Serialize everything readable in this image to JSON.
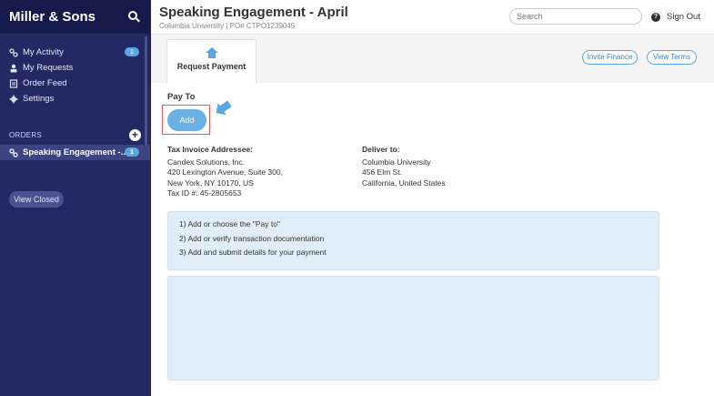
{
  "sidebar": {
    "brand": "Miller & Sons",
    "nav": [
      {
        "label": "My Activity",
        "icon": "activity-link-icon",
        "badge": "1"
      },
      {
        "label": "My Requests",
        "icon": "person-icon",
        "badge": null
      },
      {
        "label": "Order Feed",
        "icon": "document-icon",
        "badge": null
      },
      {
        "label": "Settings",
        "icon": "gear-icon",
        "badge": null
      }
    ],
    "orders_heading": "ORDERS",
    "orders": [
      {
        "label": "Speaking Engagement -...",
        "badge": "1",
        "icon": "link-icon"
      }
    ],
    "view_closed_label": "View Closed"
  },
  "header": {
    "title": "Speaking Engagement - April",
    "subtitle": "Columbia University  |  PO# CTPO1239045",
    "search_placeholder": "Search",
    "help_glyph": "?",
    "signout_label": "Sign Out"
  },
  "tabs": {
    "active_tab_label": "Request Payment",
    "invite_finance_label": "Invite Finance",
    "view_terms_label": "View Terms"
  },
  "payment": {
    "pay_to_label": "Pay To",
    "add_label": "Add",
    "tax_invoice": {
      "heading": "Tax Invoice Addressee:",
      "lines": [
        "Candex Solutions, Inc.",
        "420 Lexington Avenue, Suite 300,",
        "New York, NY 10170, US",
        "Tax ID #: 45-2805653"
      ]
    },
    "deliver_to": {
      "heading": "Deliver to:",
      "lines": [
        "Columbia University",
        "456 Elm St.",
        "California, United States"
      ]
    },
    "steps": [
      "1)  Add or choose the \"Pay to\"",
      "2)  Add or verify transaction documentation",
      "3)  Add and submit details for your payment"
    ]
  },
  "colors": {
    "sidebar_bg": "#232a63",
    "brand_bar_bg": "#141a4a",
    "accent": "#5aa7de",
    "highlight_frame": "#e05a5a",
    "info_box": "#dfeef8"
  }
}
